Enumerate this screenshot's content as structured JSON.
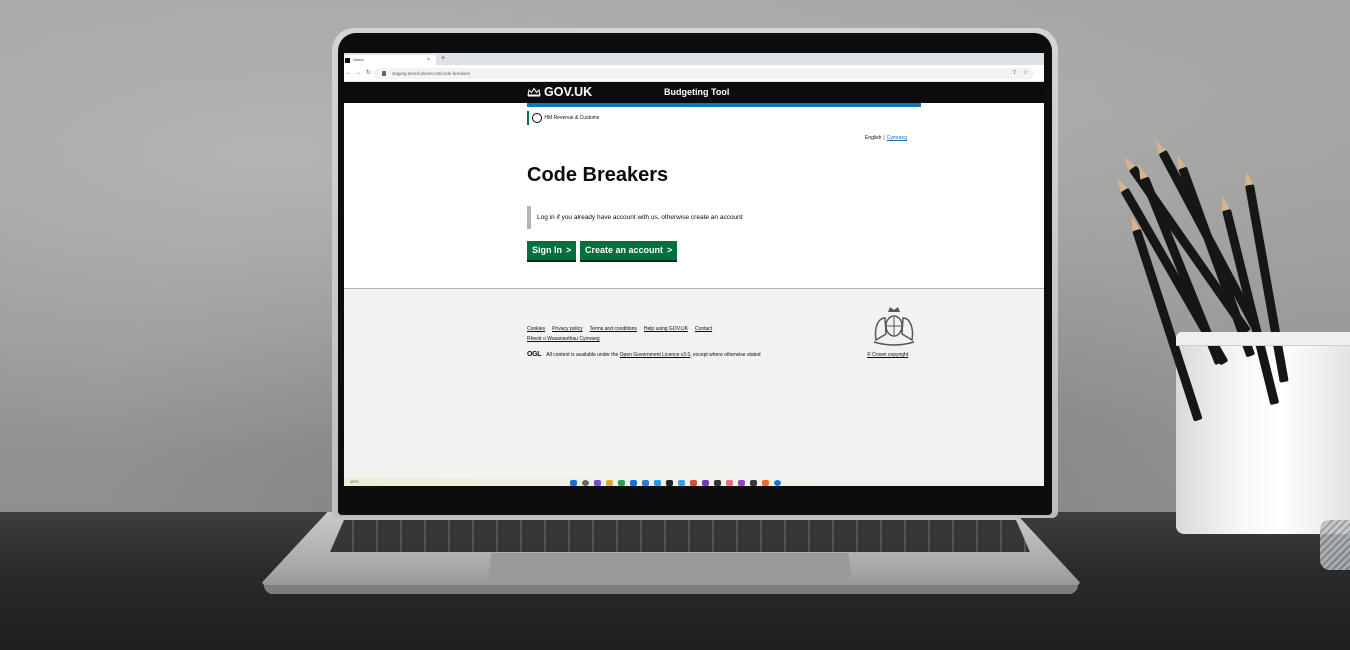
{
  "browser": {
    "tab_title": "Home",
    "tab_close": "×",
    "new_tab": "+",
    "url": "staging.tiered-planet.net/code-breakers"
  },
  "header": {
    "logo_text": "GOV.UK",
    "service_name": "Budgeting Tool",
    "department": "HM Revenue & Customs"
  },
  "language": {
    "current": "English",
    "separator": "|",
    "alternative": "Cymraeg"
  },
  "main": {
    "title": "Code Breakers",
    "inset_text": "Log in if you already have account with us, otherwise create an account",
    "buttons": [
      {
        "label": "Sign In"
      },
      {
        "label": "Create an account"
      }
    ]
  },
  "footer": {
    "links": [
      "Cookies",
      "Privacy policy",
      "Terms and conditions",
      "Help using GOV.UK",
      "Contact"
    ],
    "welsh_link": "Rhestr o Wasanaethau Cymraeg",
    "ogl_logo": "OGL",
    "licence_prefix": "All content is available under the",
    "licence_link": "Open Government Licence v3.0",
    "licence_suffix": ", except where otherwise stated",
    "copyright": "© Crown copyright"
  },
  "taskbar": {
    "weather": "19°C"
  },
  "colors": {
    "gov_black": "#0b0c0c",
    "brand_blue": "#1d70b8",
    "button_green": "#00703c",
    "footer_grey": "#f3f2f1"
  },
  "icons": [
    "crown-icon",
    "lock-icon",
    "chevron-right-icon",
    "royal-coat-of-arms-icon",
    "hmrc-crest-icon"
  ]
}
